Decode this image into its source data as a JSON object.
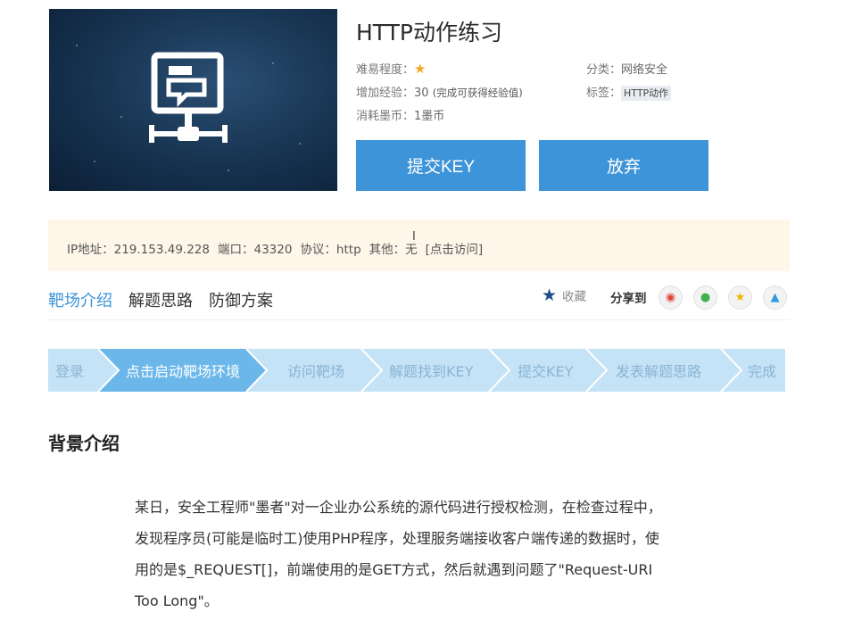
{
  "header": {
    "title": "HTTP动作练习",
    "difficulty_label": "难易程度：",
    "exp_label": "增加经验：",
    "exp_value": "30",
    "exp_note": "(完成可获得经验值)",
    "cost_label": "消耗墨币：",
    "cost_value": "1墨币",
    "category_label": "分类：",
    "category_value": "网络安全",
    "tags_label": "标签：",
    "tag": "HTTP动作"
  },
  "buttons": {
    "submit": "提交KEY",
    "abandon": "放弃"
  },
  "info": {
    "ip": "IP地址：219.153.49.228",
    "port": "端口：43320",
    "protocol": "协议：http",
    "other_label": "其他：",
    "other_value": "无",
    "visit_link": "[点击访问]"
  },
  "tabs": [
    "靶场介绍",
    "解题思路",
    "防御方案"
  ],
  "actions": {
    "favorite": "收藏",
    "share": "分享到"
  },
  "steps": [
    "登录",
    "点击启动靶场环境",
    "访问靶场",
    "解题找到KEY",
    "提交KEY",
    "发表解题思路",
    "完成"
  ],
  "active_step": 1,
  "section": {
    "title": "背景介绍",
    "lines": [
      "某日，安全工程师\"墨者\"对一企业办公系统的源代码进行授权检测，在检查过程中，",
      "发现程序员(可能是临时工)使用PHP程序，处理服务端接收客户端传递的数据时，使",
      "用的是$_REQUEST[]，前端使用的是GET方式，然后就遇到问题了\"Request-URI",
      "Too Long\"。"
    ]
  },
  "colors": {
    "accent": "#3d94d8",
    "steps_bg": "#c5e3f7",
    "steps_active": "#6cb7ea",
    "info_bg": "#fdf6e9"
  }
}
